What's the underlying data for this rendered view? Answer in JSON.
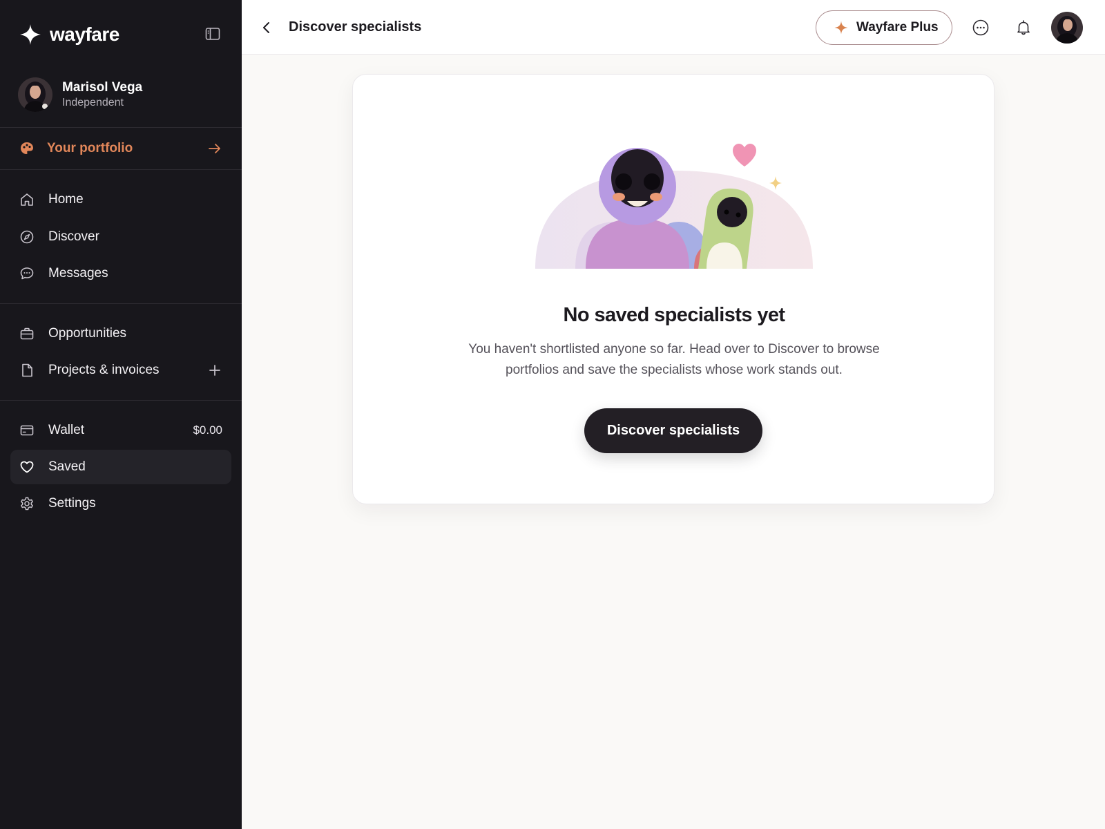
{
  "sidebar": {
    "brand": "wayfare",
    "user": {
      "name": "Marisol Vega",
      "role": "Independent"
    },
    "portfolio_label": "Your portfolio",
    "nav_primary": [
      {
        "label": "Home",
        "icon": "home-icon"
      },
      {
        "label": "Discover",
        "icon": "compass-icon"
      },
      {
        "label": "Messages",
        "icon": "chat-bubble-icon"
      }
    ],
    "nav_work": [
      {
        "label": "Opportunities",
        "icon": "briefcase-icon"
      },
      {
        "label": "Projects & invoices",
        "icon": "document-icon"
      }
    ],
    "nav_account": [
      {
        "label": "Wallet",
        "icon": "wallet-icon",
        "value": "$0.00"
      },
      {
        "label": "Saved",
        "icon": "heart-icon",
        "active": true
      },
      {
        "label": "Settings",
        "icon": "gear-icon"
      }
    ]
  },
  "header": {
    "title": "Discover specialists",
    "plus_label": "Wayfare Plus"
  },
  "empty_state": {
    "title": "No saved specialists yet",
    "description": "You haven't shortlisted anyone so far. Head over to Discover to browse portfolios and save the specialists whose work stands out.",
    "cta": "Discover specialists"
  },
  "colors": {
    "sidebar_bg": "#18171c",
    "accent_orange": "#e2875a",
    "cta_dark": "#231f25",
    "page_bg": "#faf9f7"
  }
}
